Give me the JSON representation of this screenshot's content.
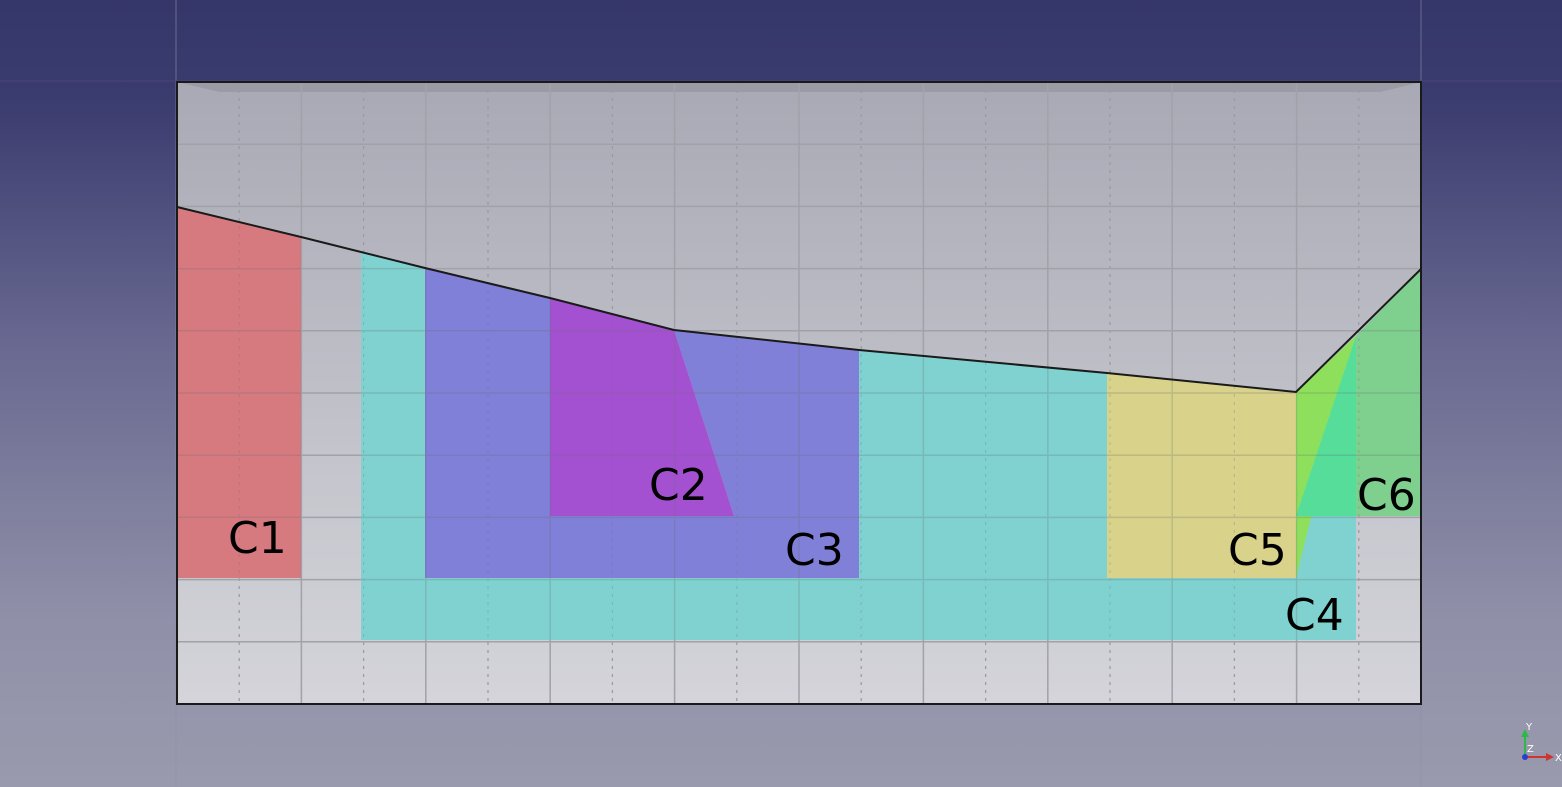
{
  "colors": {
    "background_top": "#35366a",
    "background_bottom": "#9a9aae",
    "sheet": "#cfcfd6",
    "grid_major": "#b4b4bb",
    "grid_minor": "#a9a9b0",
    "outline": "#1a1a1a",
    "cell_C1": "#d77a80",
    "cell_C2": "#a451d1",
    "cell_C3": "#8080d8",
    "cell_C4": "#7fd2d0",
    "cell_C5": "#d8d28a",
    "cell_C6_left": "#8ee05c",
    "cell_C6_right": "#7fcf8e",
    "cell_C6_mid": "#55dd99"
  },
  "labels": {
    "C1": "C1",
    "C2": "C2",
    "C3": "C3",
    "C4": "C4",
    "C5": "C5",
    "C6": "C6"
  },
  "axis_indicator": {
    "y": "Y",
    "x": "X",
    "z": "Z",
    "y_color": "#2fb84a",
    "x_color": "#d0342c",
    "z_color": "#2c3fd0"
  }
}
